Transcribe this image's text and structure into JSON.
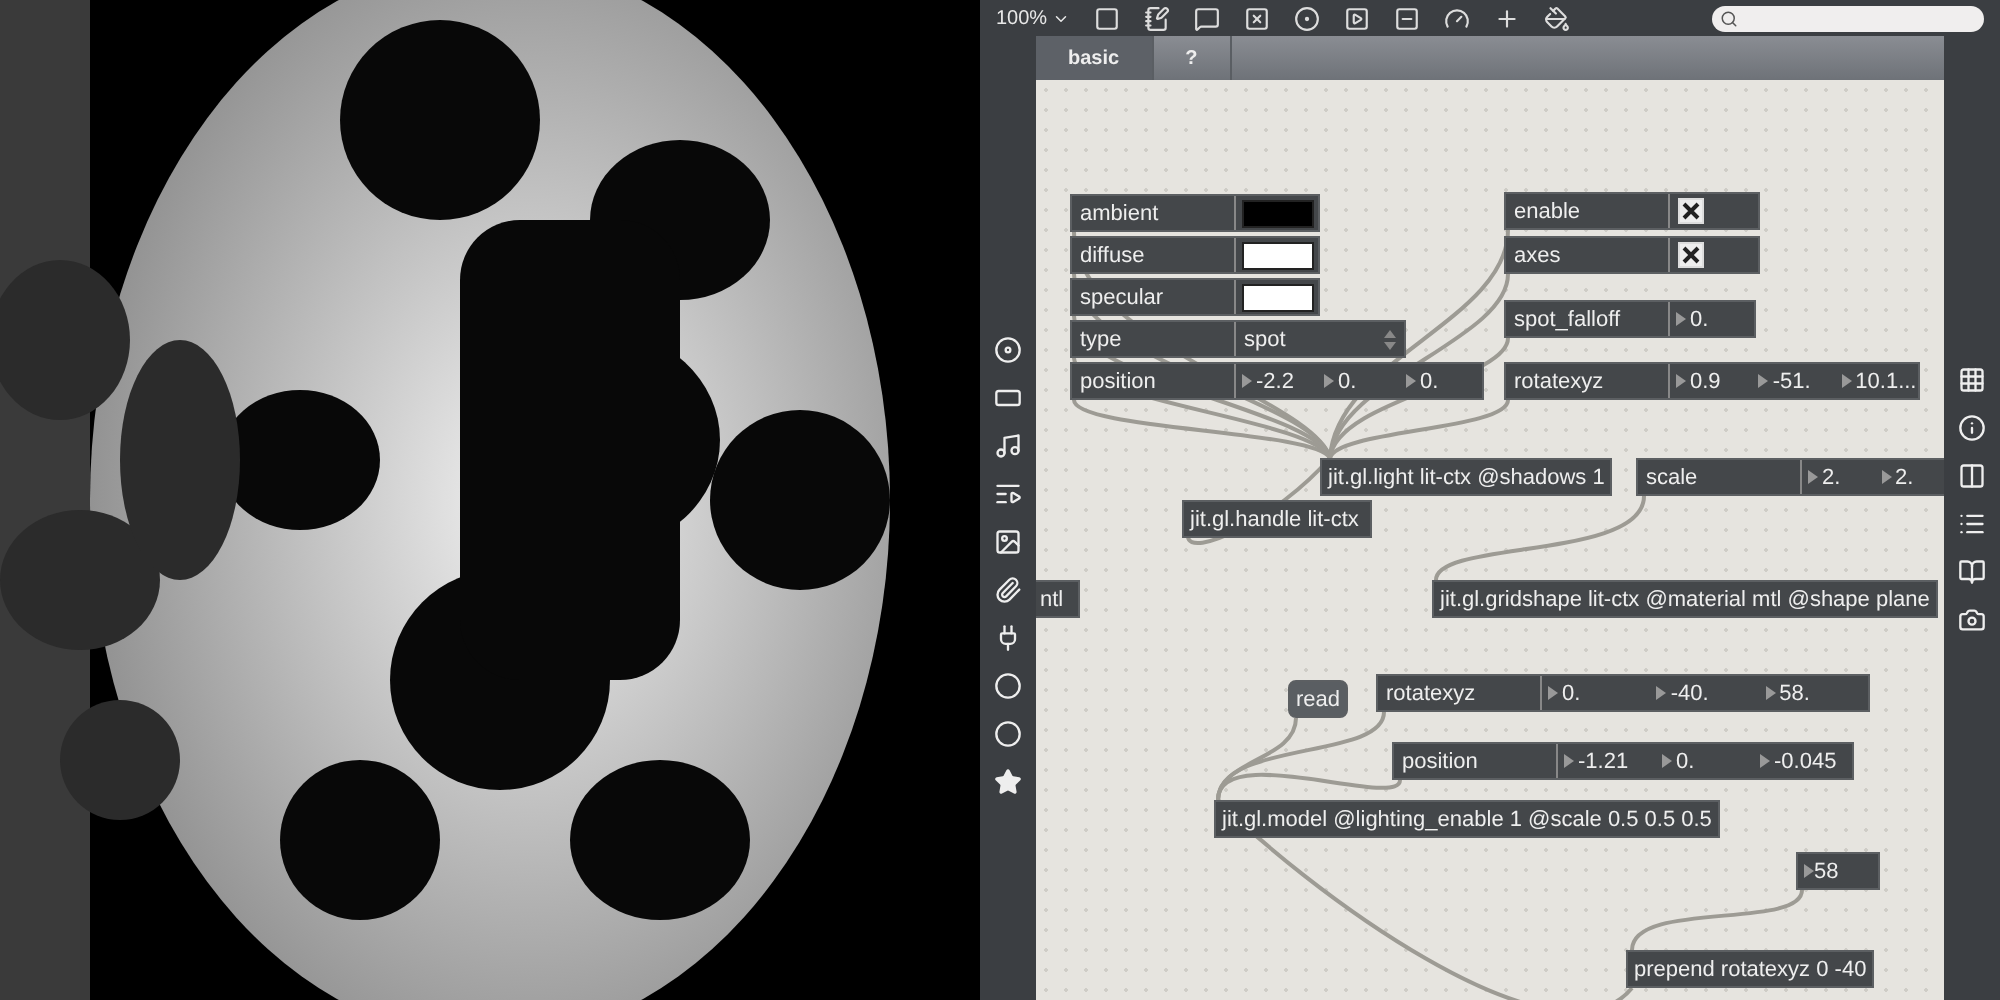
{
  "toolbar": {
    "zoom": "100%"
  },
  "tabs": [
    {
      "label": "basic",
      "selected": true
    },
    {
      "label": "?",
      "selected": false
    }
  ],
  "patch": {
    "objects": [
      {
        "kind": "color_attr",
        "label": "ambient",
        "color": "#000000"
      },
      {
        "kind": "color_attr",
        "label": "diffuse",
        "color": "#ffffff"
      },
      {
        "kind": "color_attr",
        "label": "specular",
        "color": "#ffffff"
      },
      {
        "kind": "menu_attr",
        "label": "type",
        "value": "spot"
      },
      {
        "kind": "number_attr",
        "label": "position",
        "values": [
          "-2.2",
          "0.",
          "0."
        ]
      },
      {
        "kind": "toggle_attr",
        "label": "enable",
        "checked": true
      },
      {
        "kind": "toggle_attr",
        "label": "axes",
        "checked": true
      },
      {
        "kind": "number_attr",
        "label": "spot_falloff",
        "values": [
          "0."
        ]
      },
      {
        "kind": "number_attr",
        "label": "rotatexyz",
        "values": [
          "0.9",
          "-51.",
          "10.1..."
        ]
      },
      {
        "kind": "object",
        "text": "jit.gl.light lit-ctx @shadows 1"
      },
      {
        "kind": "number_attr",
        "label": "scale",
        "values": [
          "2.",
          "2."
        ]
      },
      {
        "kind": "object",
        "text": "jit.gl.handle lit-ctx"
      },
      {
        "kind": "object",
        "text": "ntl"
      },
      {
        "kind": "object",
        "text": "jit.gl.gridshape lit-ctx @material mtl @shape plane"
      },
      {
        "kind": "message",
        "text": "read"
      },
      {
        "kind": "number_attr",
        "label": "rotatexyz",
        "values": [
          "0.",
          "-40.",
          "58."
        ]
      },
      {
        "kind": "number_attr",
        "label": "position",
        "values": [
          "-1.21",
          "0.",
          "-0.045"
        ]
      },
      {
        "kind": "object",
        "text": "jit.gl.model @lighting_enable 1 @scale 0.5 0.5 0.5"
      },
      {
        "kind": "number",
        "value": "58"
      },
      {
        "kind": "object",
        "text": "prepend rotatexyz 0 -40"
      }
    ]
  }
}
